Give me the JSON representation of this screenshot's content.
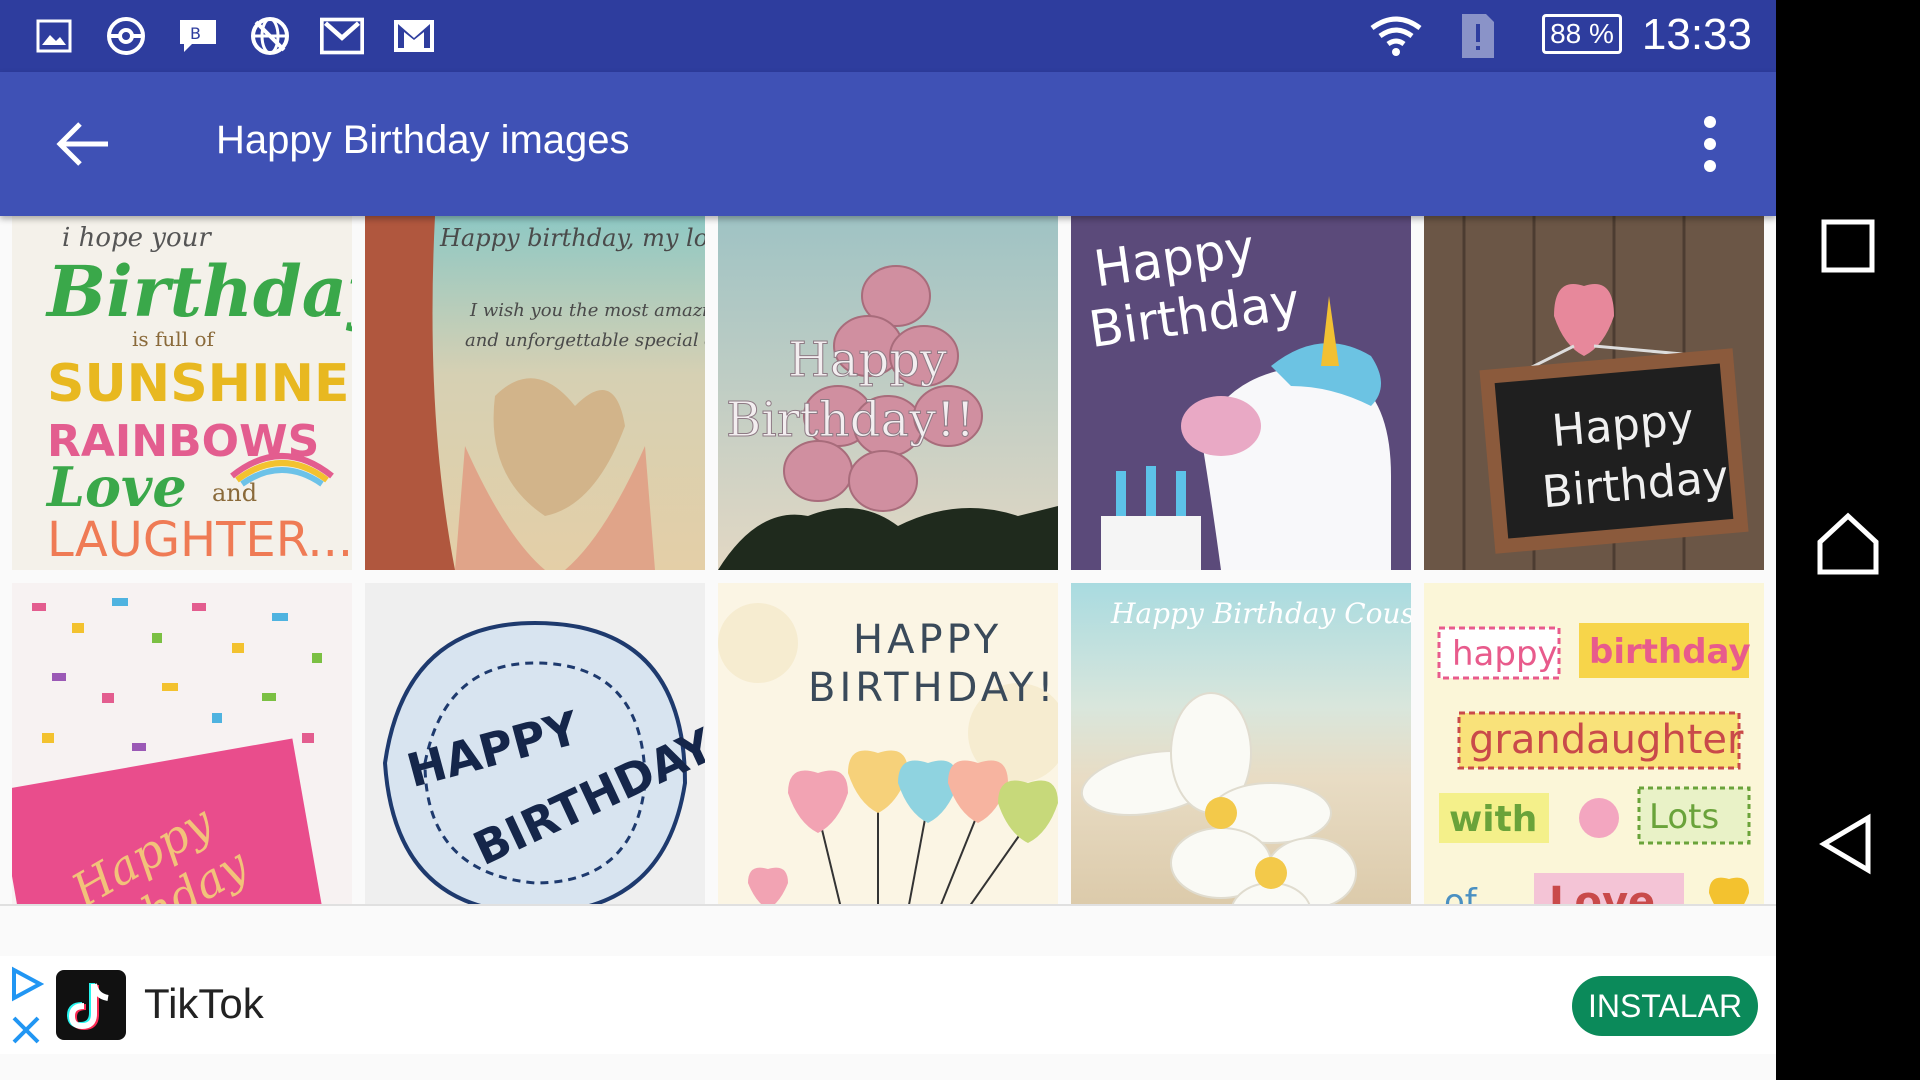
{
  "status_bar": {
    "icons": [
      "gallery-icon",
      "pokeball-icon",
      "chat-icon",
      "globe-icon",
      "gmail-icon",
      "gmail-icon"
    ],
    "wifi": "wifi-icon",
    "alert": "sim-alert-icon",
    "battery": "88 %",
    "time": "13:33"
  },
  "app_bar": {
    "title": "Happy Birthday images",
    "back_icon": "arrow-left-icon",
    "menu_icon": "more-vert-icon"
  },
  "grid": {
    "tiles": [
      {
        "text": "i hope your Birthday is full of SUNSHINE and RAINBOWS and Love and LAUGHTER...",
        "bg": "#f4f1ea"
      },
      {
        "text": "Happy birthday, my love",
        "bg": "#caa98f"
      },
      {
        "text": "Happy Birthday!!",
        "bg": "#c9ccc4"
      },
      {
        "text": "Happy Birthday",
        "bg": "#5b4a7a"
      },
      {
        "text": "Happy Birthday",
        "bg": "#6b5646"
      },
      {
        "text": "Happy Birthday",
        "bg": "#f2d9d9"
      },
      {
        "text": "HAPPY BIRTHDAY",
        "bg": "#f0f0f0"
      },
      {
        "text": "HAPPY BIRTHDAY!",
        "bg": "#fbf5e4"
      },
      {
        "text": "Happy Birthday Cousin",
        "bg": "#bfe3e6"
      },
      {
        "text": "happy birthday grandaughter with lots of Love",
        "bg": "#fbf6d8"
      }
    ]
  },
  "ad": {
    "app_name": "TikTok",
    "install_label": "INSTALAR",
    "install_color": "#0b8a5a"
  },
  "nav": {
    "recents": "square-icon",
    "home": "home-icon",
    "back": "triangle-back-icon"
  },
  "colors": {
    "status": "#2e3d9e",
    "appbar": "#3f51b5"
  }
}
